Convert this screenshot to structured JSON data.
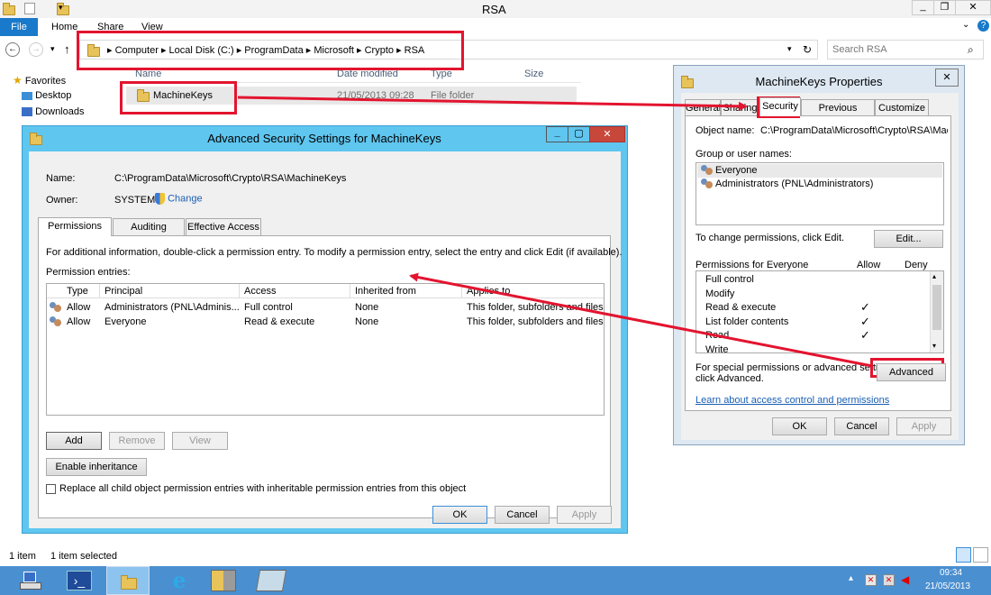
{
  "explorer": {
    "title": "RSA",
    "ribbon_tabs": [
      "File",
      "Home",
      "Share",
      "View"
    ],
    "breadcrumb": [
      "Computer",
      "Local Disk (C:)",
      "ProgramData",
      "Microsoft",
      "Crypto",
      "RSA"
    ],
    "search_placeholder": "Search RSA",
    "nav": {
      "favorites": "Favorites",
      "desktop": "Desktop",
      "downloads": "Downloads"
    },
    "columns": {
      "name": "Name",
      "date": "Date modified",
      "type": "Type",
      "size": "Size"
    },
    "rows": [
      {
        "name": "MachineKeys",
        "date": "21/05/2013 09:28",
        "type": "File folder"
      }
    ],
    "status": {
      "count": "1 item",
      "selected": "1 item selected"
    }
  },
  "advanced": {
    "title": "Advanced Security Settings for MachineKeys",
    "name_label": "Name:",
    "name_value": "C:\\ProgramData\\Microsoft\\Crypto\\RSA\\MachineKeys",
    "owner_label": "Owner:",
    "owner_value": "SYSTEM",
    "change_link": "Change",
    "tabs": [
      "Permissions",
      "Auditing",
      "Effective Access"
    ],
    "info": "For additional information, double-click a permission entry. To modify a permission entry, select the entry and click Edit (if available).",
    "entries_label": "Permission entries:",
    "columns": {
      "type": "Type",
      "principal": "Principal",
      "access": "Access",
      "inherited": "Inherited from",
      "applies": "Applies to"
    },
    "rows": [
      {
        "type": "Allow",
        "principal": "Administrators (PNL\\Adminis...",
        "access": "Full control",
        "inherited": "None",
        "applies": "This folder, subfolders and files"
      },
      {
        "type": "Allow",
        "principal": "Everyone",
        "access": "Read & execute",
        "inherited": "None",
        "applies": "This folder, subfolders and files"
      }
    ],
    "add": "Add",
    "remove": "Remove",
    "view": "View",
    "enable_inheritance": "Enable inheritance",
    "replace_checkbox": "Replace all child object permission entries with inheritable permission entries from this object",
    "ok": "OK",
    "cancel": "Cancel",
    "apply": "Apply"
  },
  "props": {
    "title": "MachineKeys Properties",
    "tabs": [
      "General",
      "Sharing",
      "Security",
      "Previous Versions",
      "Customize"
    ],
    "object_label": "Object name:",
    "object_value": "C:\\ProgramData\\Microsoft\\Crypto\\RSA\\MachineK",
    "group_label": "Group or user names:",
    "users": [
      "Everyone",
      "Administrators (PNL\\Administrators)"
    ],
    "change_text": "To change permissions, click Edit.",
    "edit": "Edit...",
    "perm_label": "Permissions for Everyone",
    "allow": "Allow",
    "deny": "Deny",
    "perms": [
      {
        "name": "Full control",
        "allow": ""
      },
      {
        "name": "Modify",
        "allow": ""
      },
      {
        "name": "Read & execute",
        "allow": "✓"
      },
      {
        "name": "List folder contents",
        "allow": "✓"
      },
      {
        "name": "Read",
        "allow": "✓"
      },
      {
        "name": "Write",
        "allow": ""
      }
    ],
    "special_1": "For special permissions or advanced settings,",
    "special_2": "click Advanced.",
    "advanced": "Advanced",
    "learn_link": "Learn about access control and permissions",
    "ok": "OK",
    "cancel": "Cancel",
    "apply": "Apply"
  },
  "taskbar": {
    "time": "09:34",
    "date": "21/05/2013"
  },
  "colors": {
    "annotation": "#e3142f",
    "title_bar": "#5fc6ef",
    "link": "#1a5fb4",
    "taskbar": "#4a8fd0"
  }
}
